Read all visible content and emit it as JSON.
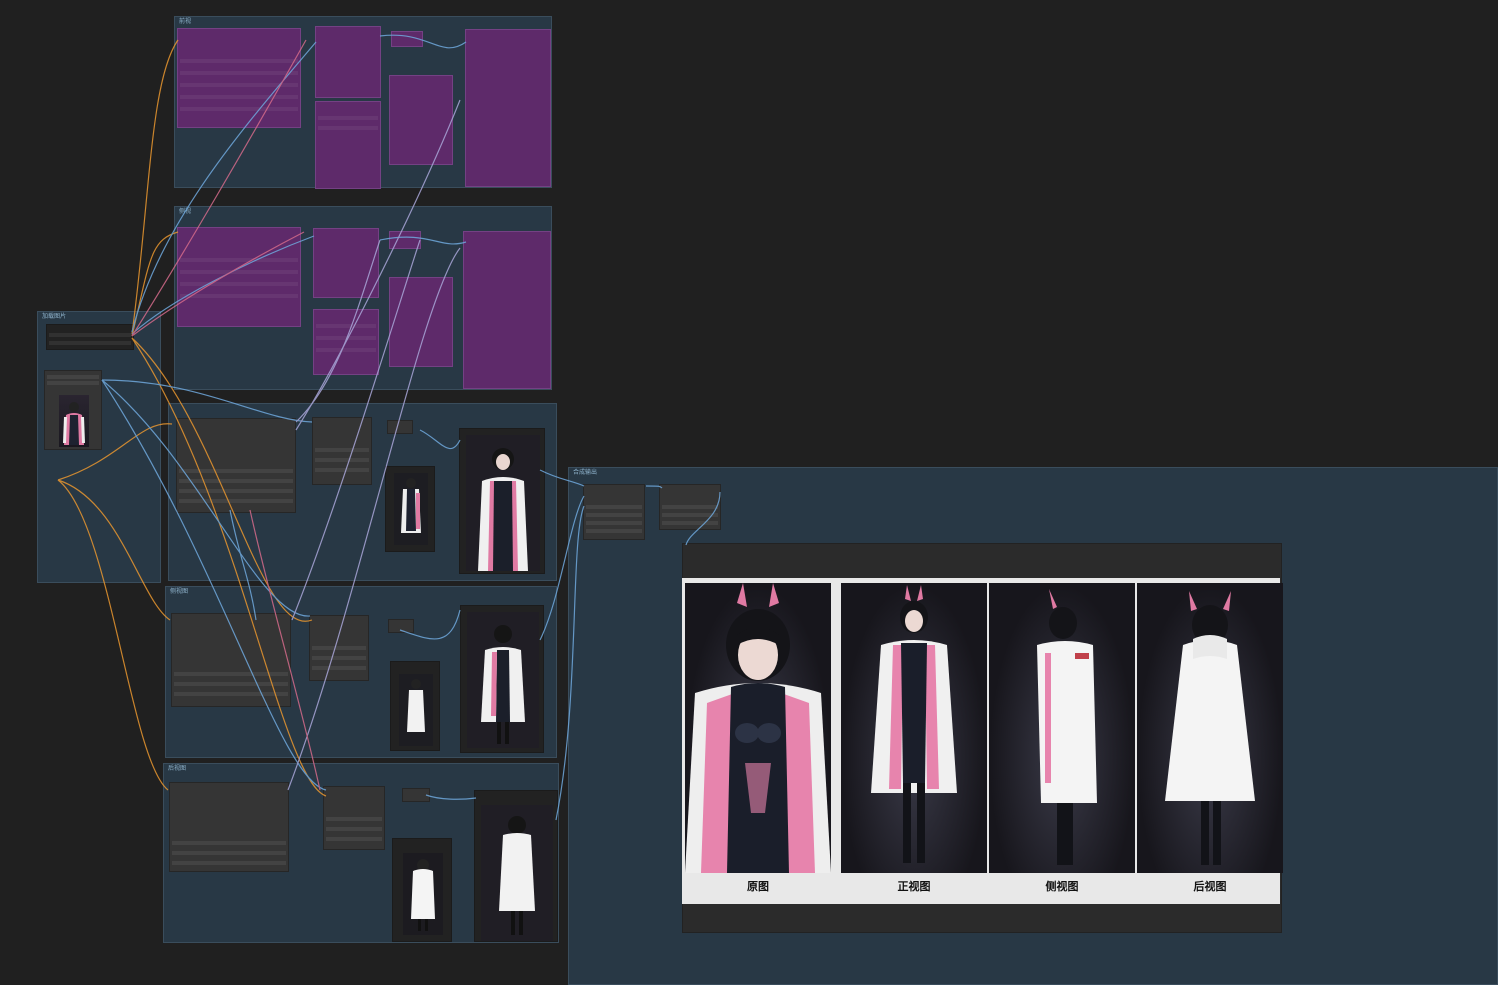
{
  "groups": {
    "top": {
      "title": "前视"
    },
    "second": {
      "title": "侧视"
    },
    "loader": {
      "title": "加载图片"
    },
    "front": {
      "title": ""
    },
    "side": {
      "title": "侧视图"
    },
    "back": {
      "title": "后视图"
    },
    "output": {
      "title": "合成输出"
    }
  },
  "preview": {
    "labels": [
      "原图",
      "正视图",
      "侧视图",
      "后视图"
    ]
  },
  "colors": {
    "canvas_bg": "#202020",
    "group_bg": "#283845",
    "node_purple": "#5e2a6a",
    "node_dark": "#353535",
    "wire_orange": "#e8962f",
    "wire_blue": "#6fa8dc",
    "wire_pink": "#d46a8a",
    "wire_lavender": "#a9a6d8"
  }
}
